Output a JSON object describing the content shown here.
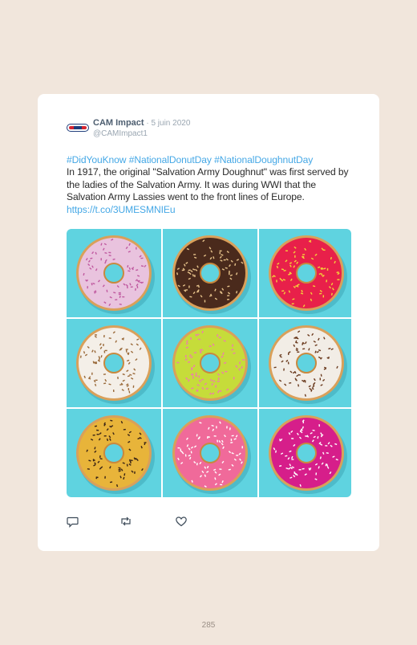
{
  "tweet": {
    "author_name": "CAM Impact",
    "separator": " · ",
    "date": "5 juin 2020",
    "handle": "@CAMImpact1",
    "hashtags": "#DidYouKnow #NationalDonutDay #NationalDoughnutDay",
    "body": "In 1917, the original \"Salvation Army Doughnut\" was first served by the ladies of the Salvation Army. It was during WWI that the Salvation Army Lassies went to the front lines of Europe.",
    "link": "https://t.co/3UMESMNIEu",
    "icons": [
      "reply-icon",
      "retweet-icon",
      "like-icon"
    ]
  },
  "colors": {
    "background": "#f1e6dc",
    "link": "#45a8e6",
    "tile": "#5fd3e0"
  },
  "donuts": [
    {
      "name": "donut-pink-sprinkles",
      "glaze": "#e9c3de",
      "sprinkle": "#c05aa0"
    },
    {
      "name": "donut-chocolate-nuts",
      "glaze": "#4a2a1c",
      "sprinkle": "#e6c28a"
    },
    {
      "name": "donut-red-yellow",
      "glaze": "#e8204a",
      "sprinkle": "#f3d23a"
    },
    {
      "name": "donut-white-chocolate",
      "glaze": "#f4efe8",
      "sprinkle": "#9a6a3a"
    },
    {
      "name": "donut-green-sprinkles",
      "glaze": "#c6dc3a",
      "sprinkle": "#f07ab0"
    },
    {
      "name": "donut-white-chocolate-sprinkles",
      "glaze": "#f2ede6",
      "sprinkle": "#6a3a1e"
    },
    {
      "name": "donut-yellow-chocolate",
      "glaze": "#e8b43a",
      "sprinkle": "#3a2416"
    },
    {
      "name": "donut-pink-white",
      "glaze": "#f06a9a",
      "sprinkle": "#ffffff"
    },
    {
      "name": "donut-magenta-white",
      "glaze": "#d61e8a",
      "sprinkle": "#ffffff"
    }
  ],
  "page_number": "285"
}
